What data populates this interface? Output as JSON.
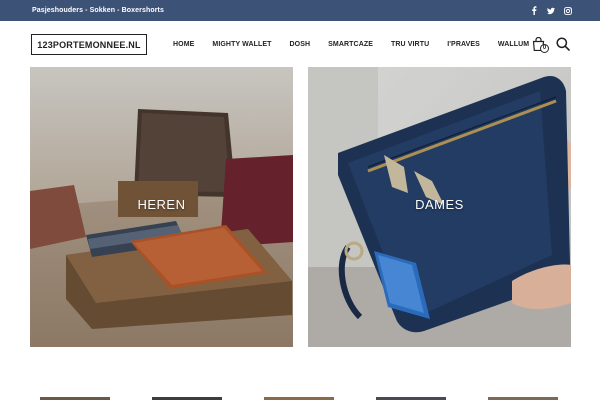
{
  "topbar": {
    "promo_text": "Pasjeshouders - Sokken - Boxershorts",
    "social": [
      "facebook-icon",
      "twitter-icon",
      "instagram-icon"
    ]
  },
  "header": {
    "logo_text": "123PORTEMONNEE.NL",
    "nav": [
      {
        "label": "HOME"
      },
      {
        "label": "MIGHTY WALLET"
      },
      {
        "label": "DOSH"
      },
      {
        "label": "SMARTCAZE"
      },
      {
        "label": "TRU VIRTU"
      },
      {
        "label": "I'PRAVES"
      },
      {
        "label": "WALLUM"
      }
    ],
    "cart_count": "0"
  },
  "categories": [
    {
      "label": "HEREN"
    },
    {
      "label": "DAMES"
    }
  ],
  "colors": {
    "topbar": "#3d5277",
    "text": "#222222"
  }
}
